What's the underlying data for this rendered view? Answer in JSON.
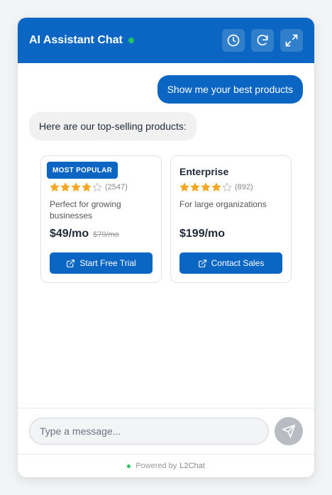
{
  "header": {
    "title": "AI Assistant Chat",
    "status_color": "#22c55e",
    "brand_color": "#0a66c2",
    "actions": [
      {
        "name": "history",
        "icon": "clock-icon"
      },
      {
        "name": "refresh",
        "icon": "refresh-icon"
      },
      {
        "name": "expand",
        "icon": "expand-icon"
      }
    ]
  },
  "messages": [
    {
      "role": "user",
      "text": "Show me your best products"
    },
    {
      "role": "assistant",
      "text": "Here are our top-selling products:"
    }
  ],
  "products": [
    {
      "badge": "MOST POPULAR",
      "name": "",
      "rating": 4,
      "rating_max": 5,
      "reviews": "(2547)",
      "description": "Perfect for growing businesses",
      "price": "$49/mo",
      "old_price": "$79/mo",
      "cta": "Start Free Trial",
      "cta_icon": "external-link-icon"
    },
    {
      "badge": "",
      "name": "Enterprise",
      "rating": 4,
      "rating_max": 5,
      "reviews": "(892)",
      "description": "For large organizations",
      "price": "$199/mo",
      "old_price": "",
      "cta": "Contact Sales",
      "cta_icon": "external-link-icon"
    }
  ],
  "composer": {
    "placeholder": "Type a message...",
    "send_icon": "send-icon"
  },
  "footer": {
    "prefix": "Powered by",
    "brand": "L2Chat"
  }
}
